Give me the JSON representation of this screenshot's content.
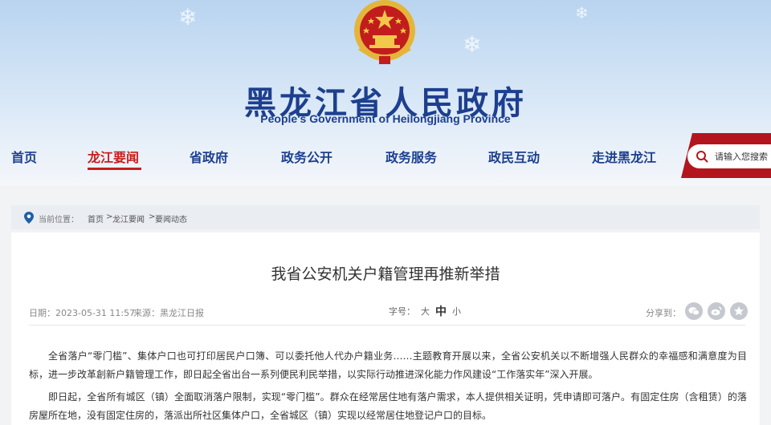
{
  "header": {
    "title": "黑龙江省人民政府",
    "subtitle": "People's Government of Heilongjiang Province",
    "emblem_icon": "national-emblem-icon",
    "accent_color": "#c91c1c",
    "brand_color": "#1d3f8f"
  },
  "nav": {
    "items": [
      {
        "label": "首页"
      },
      {
        "label": "龙江要闻"
      },
      {
        "label": "省政府"
      },
      {
        "label": "政务公开"
      },
      {
        "label": "政务服务"
      },
      {
        "label": "政民互动"
      },
      {
        "label": "走进黑龙江"
      }
    ],
    "active_index": 1
  },
  "search": {
    "placeholder": "请输入您搜索",
    "icon": "search-icon"
  },
  "breadcrumb": {
    "label": "当前位置：",
    "items": [
      "首页",
      ">",
      "龙江要闻",
      ">",
      "要闻动态"
    ],
    "icon": "location-pin-icon"
  },
  "article": {
    "title": "我省公安机关户籍管理再推新举措",
    "date": "日期：2023-05-31 11:57",
    "source": "来源：黑龙江日报",
    "font_size": {
      "label": "字号：",
      "large": "大",
      "medium": "中",
      "small": "小"
    },
    "share_label": "分享到：",
    "share_icons": [
      "wechat-icon",
      "weibo-icon",
      "favorite-icon"
    ],
    "paragraphs": [
      "全省落户“零门槛”、集体户口也可打印居民户口簿、可以委托他人代办户籍业务……主题教育开展以来，全省公安机关以不断增强人民群众的幸福感和满意度为目标，进一步改革創新户籍管理工作，即日起全省出台一系列便民利民举措，以实际行动推进深化能力作风建设“工作落实年”深入开展。",
      "即日起，全省所有城区（镇）全面取消落户限制，实现“零门槛”。群众在经常居住地有落户需求，本人提供相关证明，凭申请即可落户。有固定住房（含租赁）的落房屋所在地，没有固定住房的，落派出所社区集体户口，全省城区（镇）实现以经常居住地登记户口的目标。"
    ]
  }
}
